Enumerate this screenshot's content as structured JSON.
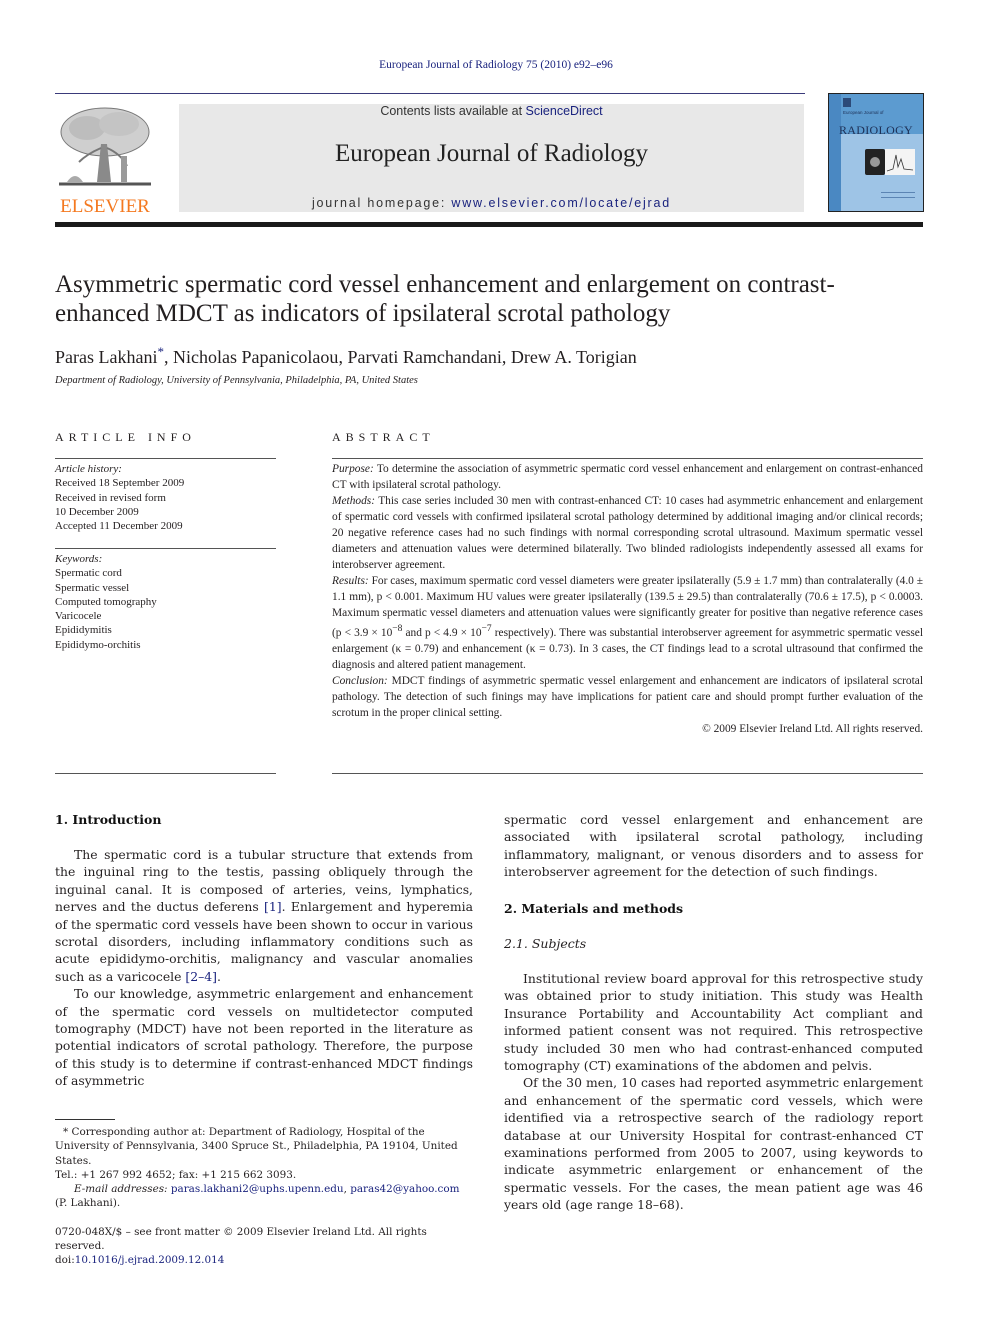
{
  "running_head": "European Journal of Radiology 75 (2010) e92–e96",
  "masthead": {
    "publisher_logo": "ELSEVIER",
    "contents_prefix": "Contents lists available at ",
    "contents_link": "ScienceDirect",
    "journal_name": "European Journal of Radiology",
    "homepage_prefix": "journal homepage: ",
    "homepage_link": "www.elsevier.com/locate/ejrad",
    "cover_small": "European Journal of",
    "cover_title": "RADIOLOGY"
  },
  "article": {
    "title": "Asymmetric spermatic cord vessel enhancement and enlargement on contrast-enhanced MDCT as indicators of ipsilateral scrotal pathology",
    "authors": [
      {
        "name": "Paras Lakhani",
        "mark": "*"
      },
      {
        "name": "Nicholas Papanicolaou"
      },
      {
        "name": "Parvati Ramchandani"
      },
      {
        "name": "Drew A. Torigian"
      }
    ],
    "affiliation": "Department of Radiology, University of Pennsylvania, Philadelphia, PA, United States"
  },
  "article_info": {
    "heading": "ARTICLE INFO",
    "history_label": "Article history:",
    "history": [
      "Received 18 September 2009",
      "Received in revised form",
      "10 December 2009",
      "Accepted 11 December 2009"
    ],
    "keywords_label": "Keywords:",
    "keywords": [
      "Spermatic cord",
      "Spermatic vessel",
      "Computed tomography",
      "Varicocele",
      "Epididymitis",
      "Epididymo-orchitis"
    ]
  },
  "abstract": {
    "heading": "ABSTRACT",
    "purpose_label": "Purpose:",
    "purpose": " To determine the association of asymmetric spermatic cord vessel enhancement and enlargement on contrast-enhanced CT with ipsilateral scrotal pathology.",
    "methods_label": "Methods:",
    "methods": " This case series included 30 men with contrast-enhanced CT: 10 cases had asymmetric enhancement and enlargement of spermatic cord vessels with confirmed ipsilateral scrotal pathology determined by additional imaging and/or clinical records; 20 negative reference cases had no such findings with normal corresponding scrotal ultrasound. Maximum spermatic vessel diameters and attenuation values were determined bilaterally. Two blinded radiologists independently assessed all exams for interobserver agreement.",
    "results_label": "Results:",
    "results_1": " For cases, maximum spermatic cord vessel diameters were greater ipsilaterally (5.9 ± 1.7 mm) than contralaterally (4.0 ± 1.1 mm), p < 0.001. Maximum HU values were greater ipsilaterally (139.5 ± 29.5) than contralaterally (70.6 ± 17.5), p < 0.0003. Maximum spermatic vessel diameters and attenuation values were significantly greater for positive than negative reference cases (p < 3.9 × 10",
    "results_exp1": "−8",
    "results_2": " and p < 4.9 × 10",
    "results_exp2": "−7",
    "results_3": " respectively). There was substantial interobserver agreement for asymmetric spermatic vessel enlargement (κ = 0.79) and enhancement (κ = 0.73). In 3 cases, the CT findings lead to a scrotal ultrasound that confirmed the diagnosis and altered patient management.",
    "conclusion_label": "Conclusion:",
    "conclusion": " MDCT findings of asymmetric spermatic vessel enlargement and enhancement are indicators of ipsilateral scrotal pathology. The detection of such finings may have implications for patient care and should prompt further evaluation of the scrotum in the proper clinical setting.",
    "copyright": "© 2009 Elsevier Ireland Ltd. All rights reserved."
  },
  "body": {
    "intro_heading": "1.  Introduction",
    "intro_p1_a": "The spermatic cord is a tubular structure that extends from the inguinal ring to the testis, passing obliquely through the inguinal canal. It is composed of arteries, veins, lymphatics, nerves and the ductus deferens ",
    "intro_p1_ref1": "[1]",
    "intro_p1_b": ". Enlargement and hyperemia of the spermatic cord vessels have been shown to occur in various scrotal disorders, including inflammatory conditions such as acute epididymo-orchitis, malignancy and vascular anomalies such as a varicocele ",
    "intro_p1_ref2": "[2–4]",
    "intro_p1_c": ".",
    "intro_p2": "To our knowledge, asymmetric enlargement and enhancement of the spermatic cord vessels on multidetector computed tomography (MDCT) have not been reported in the literature as potential indicators of scrotal pathology. Therefore, the purpose of this study is to determine if contrast-enhanced MDCT findings of asymmetric",
    "intro_p2_cont": "spermatic cord vessel enlargement and enhancement are associated with ipsilateral scrotal pathology, including inflammatory, malignant, or venous disorders and to assess for interobserver agreement for the detection of such findings.",
    "methods_heading": "2.  Materials and methods",
    "subjects_heading": "2.1.  Subjects",
    "subjects_p1": "Institutional review board approval for this retrospective study was obtained prior to study initiation. This study was Health Insurance Portability and Accountability Act compliant and informed patient consent was not required. This retrospective study included 30 men who had contrast-enhanced computed tomography (CT) examinations of the abdomen and pelvis.",
    "subjects_p2": "Of the 30 men, 10 cases had reported asymmetric enlargement and enhancement of the spermatic cord vessels, which were identified via a retrospective search of the radiology report database at our University Hospital for contrast-enhanced CT examinations performed from 2005 to 2007, using keywords to indicate asymmetric enlargement or enhancement of the spermatic vessels. For the cases, the mean patient age was 46 years old (age range 18–68)."
  },
  "footnotes": {
    "corresponding": "* Corresponding author at: Department of Radiology, Hospital of the University of Pennsylvania, 3400 Spruce St., Philadelphia, PA 19104, United States.",
    "tel": "Tel.: +1 267 992 4652; fax: +1 215 662 3093.",
    "email_label": "E-mail addresses:",
    "email1": "paras.lakhani2@uphs.upenn.edu",
    "email_sep": ", ",
    "email2": "paras42@yahoo.com",
    "email_owner": "(P. Lakhani).",
    "front_matter": "0720-048X/$ – see front matter © 2009 Elsevier Ireland Ltd. All rights reserved.",
    "doi_prefix": "doi:",
    "doi": "10.1016/j.ejrad.2009.12.014"
  },
  "colors": {
    "link": "#1a237e",
    "elsevier_orange": "#f47920",
    "banner_gray": "#e8e8e8",
    "cover_blue": "#5c9bd0"
  }
}
